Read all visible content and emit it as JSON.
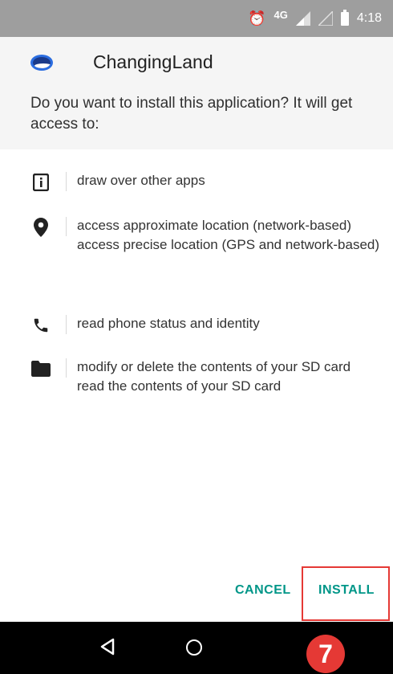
{
  "status_bar": {
    "network": "4G",
    "time": "4:18",
    "icons": [
      "alarm-icon",
      "signal-icon",
      "signal-icon",
      "battery-icon"
    ]
  },
  "header": {
    "app_name": "ChangingLand",
    "question": "Do you want to install this application? It will get access to:"
  },
  "permissions": [
    {
      "icon": "info-icon",
      "lines": [
        "draw over other apps"
      ]
    },
    {
      "icon": "location-icon",
      "lines": [
        "access approximate location (network-based)",
        "access precise location (GPS and network-based)"
      ]
    },
    {
      "icon": "phone-icon",
      "lines": [
        "read phone status and identity"
      ]
    },
    {
      "icon": "folder-icon",
      "lines": [
        "modify or delete the contents of your SD card",
        "read the contents of your SD card"
      ]
    }
  ],
  "actions": {
    "cancel_label": "CANCEL",
    "install_label": "INSTALL"
  },
  "annotation": {
    "step_number": "7"
  },
  "colors": {
    "accent": "#009688",
    "highlight": "#e53935",
    "status_bar": "#9e9e9e"
  }
}
